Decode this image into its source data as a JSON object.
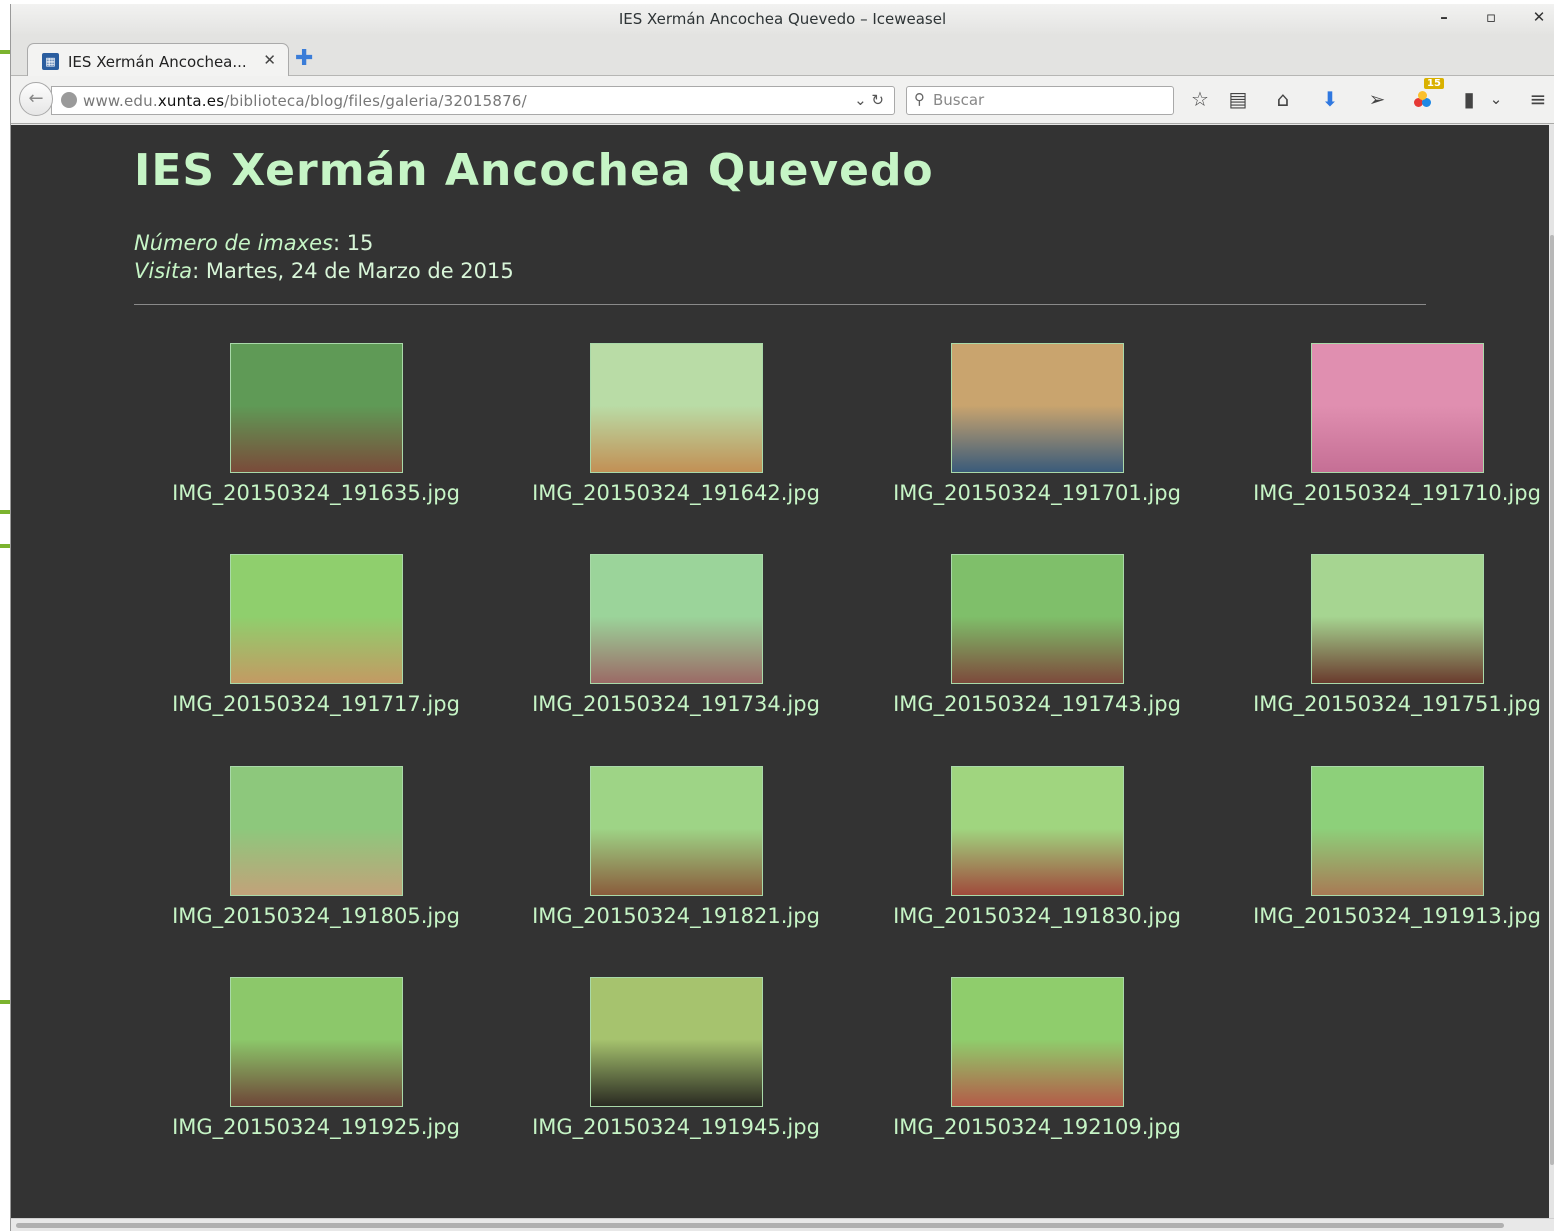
{
  "window": {
    "title": "IES Xermán Ancochea Quevedo – Iceweasel",
    "minimize": "–",
    "maximize": "▫",
    "close": "✕"
  },
  "tab": {
    "title": "IES Xermán Ancochea...",
    "close": "✕",
    "new_tab": "✚"
  },
  "navbar": {
    "url_host_prefix": "www.edu.",
    "url_host_main": "xunta.es",
    "url_path": "/biblioteca/blog/files/galeria/32015876/",
    "search_placeholder": "Buscar",
    "addon_badge": "15"
  },
  "page": {
    "title": "IES Xermán Ancochea Quevedo",
    "count_label": "Número de imaxes",
    "count_value": ": 15",
    "visit_label": "Visita",
    "visit_value": ": Martes, 24 de Marzo de 2015"
  },
  "gallery": [
    {
      "file": "IMG_20150324_191635.jpg",
      "colors": [
        "#5f9a56",
        "#7a4b3a"
      ]
    },
    {
      "file": "IMG_20150324_191642.jpg",
      "colors": [
        "#b9dca6",
        "#c29055"
      ]
    },
    {
      "file": "IMG_20150324_191701.jpg",
      "colors": [
        "#c9a46e",
        "#3a5b7a"
      ]
    },
    {
      "file": "IMG_20150324_191710.jpg",
      "colors": [
        "#e08fb0",
        "#c56f95"
      ]
    },
    {
      "file": "IMG_20150324_191717.jpg",
      "colors": [
        "#8fcf6d",
        "#c39a63"
      ]
    },
    {
      "file": "IMG_20150324_191734.jpg",
      "colors": [
        "#9bd49a",
        "#9b6a66"
      ]
    },
    {
      "file": "IMG_20150324_191743.jpg",
      "colors": [
        "#7fbf6a",
        "#7d4a3c"
      ]
    },
    {
      "file": "IMG_20150324_191751.jpg",
      "colors": [
        "#a6d591",
        "#6a3b2e"
      ]
    },
    {
      "file": "IMG_20150324_191805.jpg",
      "colors": [
        "#8dc87c",
        "#c2a27a"
      ]
    },
    {
      "file": "IMG_20150324_191821.jpg",
      "colors": [
        "#9ed486",
        "#8a5c3c"
      ]
    },
    {
      "file": "IMG_20150324_191830.jpg",
      "colors": [
        "#a0d57f",
        "#a04a3c"
      ]
    },
    {
      "file": "IMG_20150324_191913.jpg",
      "colors": [
        "#8dd07a",
        "#a87a55"
      ]
    },
    {
      "file": "IMG_20150324_191925.jpg",
      "colors": [
        "#8cc86a",
        "#6e4638"
      ]
    },
    {
      "file": "IMG_20150324_191945.jpg",
      "colors": [
        "#a6c36e",
        "#2a2a22"
      ]
    },
    {
      "file": "IMG_20150324_192109.jpg",
      "colors": [
        "#8fcd6c",
        "#b35b48"
      ]
    }
  ]
}
